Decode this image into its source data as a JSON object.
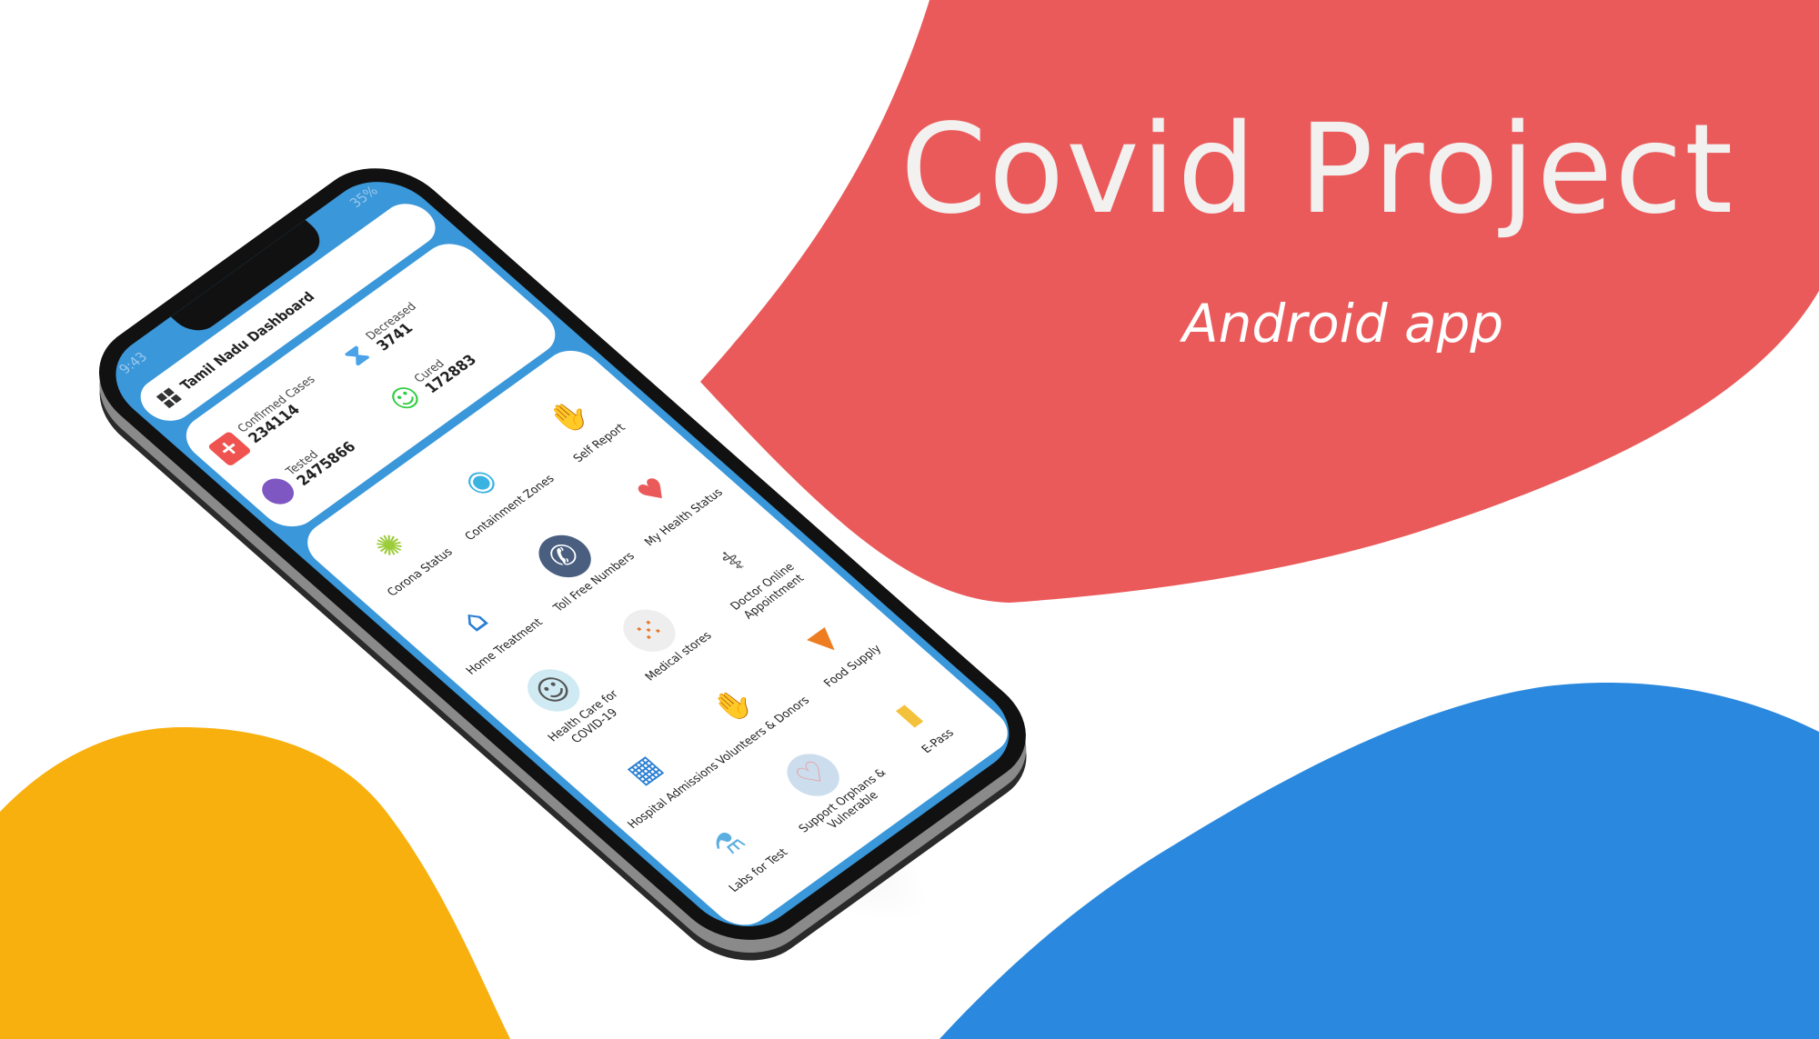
{
  "banner": {
    "title": "Covid Project",
    "subtitle": "Android app"
  },
  "colors": {
    "red": "#EB5A5A",
    "yellow": "#F8B00E",
    "blue": "#2A89DF",
    "app_blue": "#3A97D9"
  },
  "status_bar": {
    "time": "9:43",
    "battery": "35%"
  },
  "app": {
    "title": "Tamil Nadu Dashboard",
    "stats": [
      {
        "label": "Confirmed Cases",
        "value": "234114",
        "icon": "plus-icon",
        "color": "#EF5350"
      },
      {
        "label": "Decreased",
        "value": "3741",
        "icon": "hourglass-icon",
        "color": "#4AA3E8"
      },
      {
        "label": "Tested",
        "value": "2475866",
        "icon": "tested-icon",
        "color": "#7E57C2"
      },
      {
        "label": "Cured",
        "value": "172883",
        "icon": "smiley-icon",
        "color": "#2ECC40"
      }
    ],
    "services": [
      {
        "label": "Corona Status",
        "icon": "virus-icon"
      },
      {
        "label": "Containment Zones",
        "icon": "globe-icon"
      },
      {
        "label": "Self Report",
        "icon": "hand-icon"
      },
      {
        "label": "Home Treatment",
        "icon": "home-shield-icon"
      },
      {
        "label": "Toll Free Numbers",
        "icon": "phone-icon"
      },
      {
        "label": "My Health Status",
        "icon": "heart-icon"
      },
      {
        "label": "Health Care for COVID-19",
        "icon": "patient-icon"
      },
      {
        "label": "Medical stores",
        "icon": "pills-icon"
      },
      {
        "label": "Doctor Online Appointment",
        "icon": "doctor-icon"
      },
      {
        "label": "Hospital Admissions",
        "icon": "hospital-icon"
      },
      {
        "label": "Volunteers & Donors",
        "icon": "hands-icon"
      },
      {
        "label": "Food Supply",
        "icon": "carrot-icon"
      },
      {
        "label": "Labs for Test",
        "icon": "flask-icon"
      },
      {
        "label": "Support Orphans & Vulnerable",
        "icon": "support-icon"
      },
      {
        "label": "E-Pass",
        "icon": "ticket-icon"
      }
    ]
  }
}
